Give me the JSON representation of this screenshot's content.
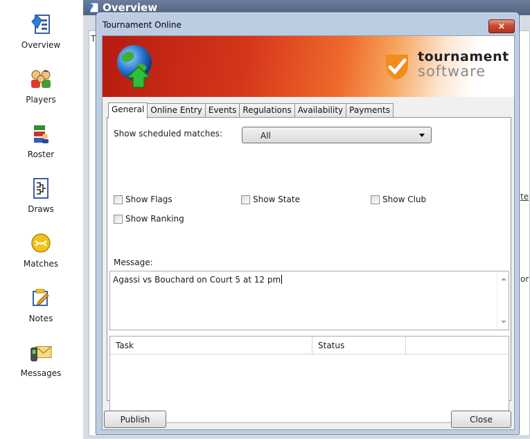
{
  "sidebar": {
    "items": [
      {
        "label": "Overview",
        "icon": "overview-icon"
      },
      {
        "label": "Players",
        "icon": "players-icon"
      },
      {
        "label": "Roster",
        "icon": "roster-icon"
      },
      {
        "label": "Draws",
        "icon": "draws-icon"
      },
      {
        "label": "Matches",
        "icon": "matches-icon"
      },
      {
        "label": "Notes",
        "icon": "notes-icon"
      },
      {
        "label": "Messages",
        "icon": "messages-icon"
      }
    ]
  },
  "background": {
    "title": "Overview",
    "fragments": [
      "T",
      "te",
      "or"
    ]
  },
  "dialog": {
    "title": "Tournament Online",
    "close_label": "×",
    "logo": {
      "line1": "tournament",
      "line2": "software"
    },
    "tabs": [
      {
        "label": "General",
        "active": true
      },
      {
        "label": "Online Entry",
        "active": false
      },
      {
        "label": "Events",
        "active": false
      },
      {
        "label": "Regulations",
        "active": false
      },
      {
        "label": "Availability",
        "active": false
      },
      {
        "label": "Payments",
        "active": false
      }
    ],
    "general": {
      "scheduled_label": "Show scheduled matches:",
      "scheduled_value": "All",
      "checkboxes": {
        "flags": {
          "label": "Show Flags",
          "checked": false
        },
        "state": {
          "label": "Show State",
          "checked": false
        },
        "club": {
          "label": "Show Club",
          "checked": false
        },
        "ranking": {
          "label": "Show Ranking",
          "checked": false
        }
      },
      "message_label": "Message:",
      "message_value": "Agassi vs Bouchard on Court 5 at 12 pm",
      "grid_headers": {
        "task": "Task",
        "status": "Status"
      }
    },
    "buttons": {
      "publish": "Publish",
      "close": "Close"
    }
  },
  "colors": {
    "banner_red": "#b51c10",
    "banner_orange": "#ef6a2c",
    "dialog_frame": "#bccde2",
    "close_red": "#c94a33"
  }
}
